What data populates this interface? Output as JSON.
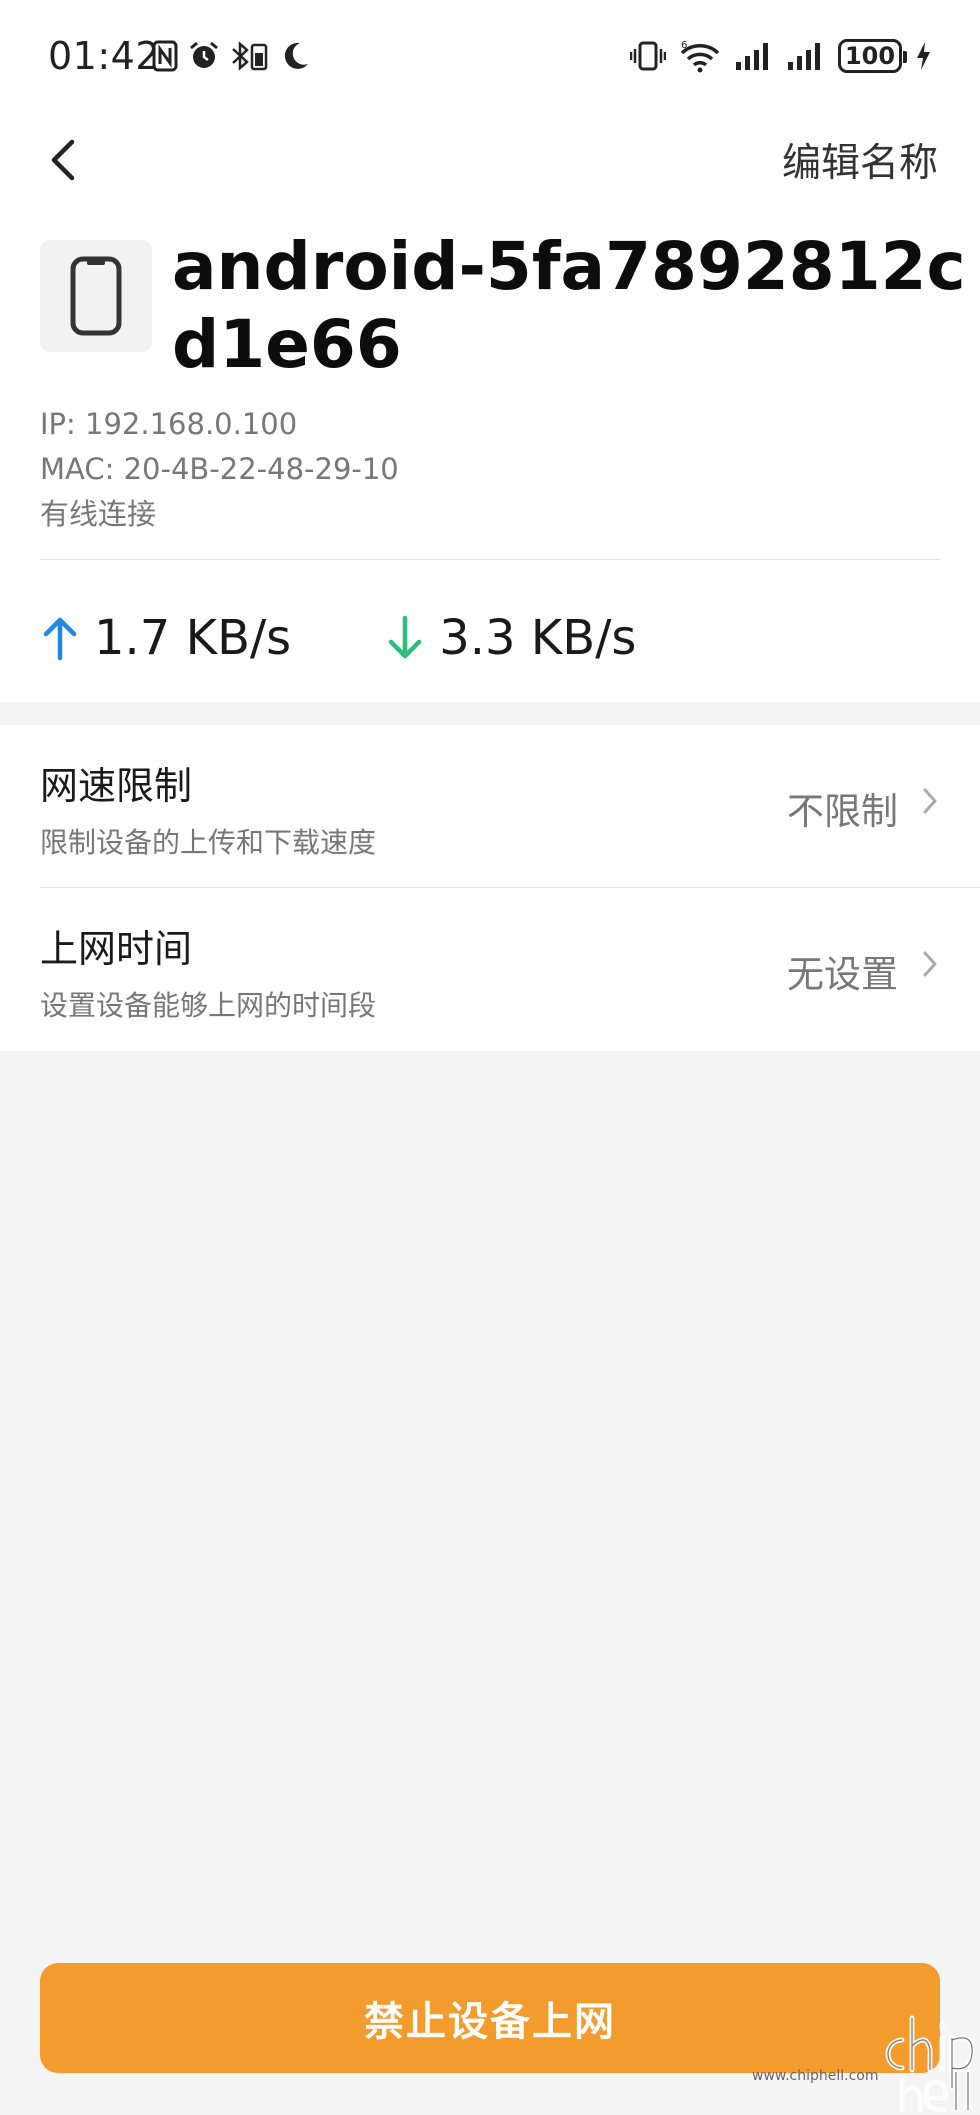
{
  "status_bar": {
    "time": "01:42",
    "battery": "100",
    "icons": [
      "nfc-icon",
      "alarm-icon",
      "bluetooth-battery-icon",
      "moon-icon",
      "vibrate-icon",
      "wifi-6-icon",
      "signal-icon",
      "signal-icon",
      "battery-icon",
      "charging-icon"
    ]
  },
  "nav": {
    "back_icon": "chevron-left-icon",
    "edit_name_label": "编辑名称"
  },
  "device": {
    "icon": "smartphone-icon",
    "name": "android-5fa7892812cd1e66",
    "ip": "IP: 192.168.0.100",
    "mac": "MAC: 20-4B-22-48-29-10",
    "connection": "有线连接"
  },
  "speed": {
    "upload": "1.7 KB/s",
    "download": "3.3 KB/s",
    "upload_color": "#1e88e5",
    "download_color": "#2ebd7a"
  },
  "settings": [
    {
      "title": "网速限制",
      "description": "限制设备的上传和下载速度",
      "value": "不限制"
    },
    {
      "title": "上网时间",
      "description": "设置设备能够上网的时间段",
      "value": "无设置"
    }
  ],
  "actions": {
    "block_label": "禁止设备上网",
    "block_color": "#f39c2d"
  },
  "watermark": {
    "site": "www.chiphell.com"
  }
}
